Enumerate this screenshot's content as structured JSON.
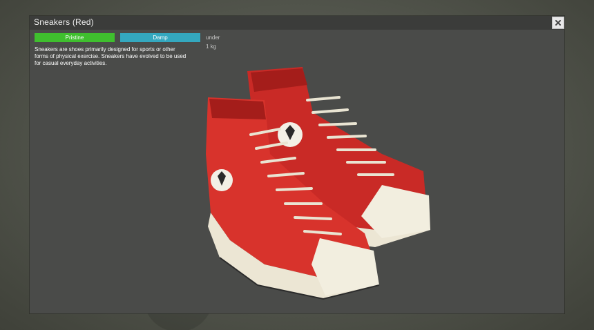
{
  "item": {
    "title": "Sneakers (Red)",
    "condition": "Pristine",
    "wetness": "Damp",
    "weight": "under 1 kg",
    "description": "Sneakers are shoes primarily designed for sports or other forms of physical exercise. Sneakers have evolved to be used for casual everyday activities."
  },
  "colors": {
    "condition_badge": "#3fbf2e",
    "wetness_badge": "#34a8bf",
    "window_bg": "#4a4b49",
    "titlebar_bg": "#3b3c3a",
    "shoe_red": "#d8332c",
    "shoe_sole": "#ece6d4"
  },
  "icons": {
    "close": "close-icon",
    "preview": "sneakers-3d-preview"
  }
}
